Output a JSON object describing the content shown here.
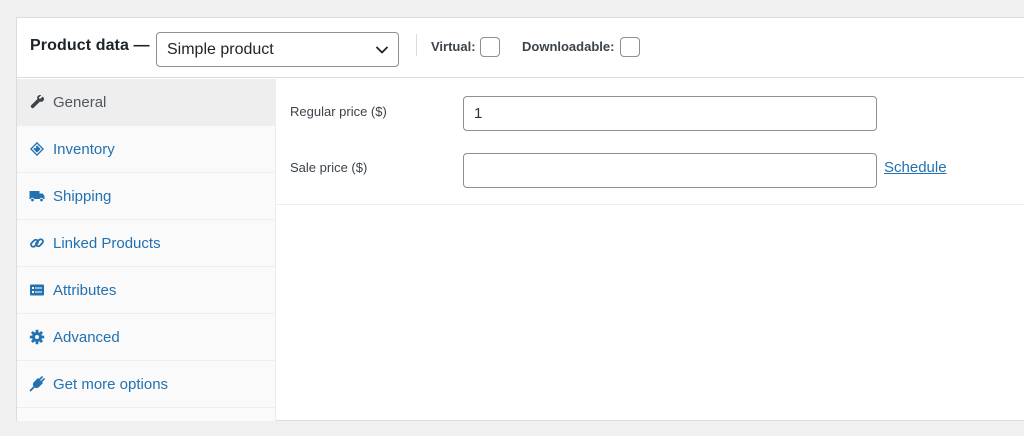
{
  "header": {
    "title": "Product data —",
    "product_type": "Simple product",
    "virtual_label": "Virtual:",
    "downloadable_label": "Downloadable:"
  },
  "tabs": [
    {
      "label": "General",
      "icon": "wrench-icon",
      "active": true
    },
    {
      "label": "Inventory",
      "icon": "tag-icon",
      "active": false
    },
    {
      "label": "Shipping",
      "icon": "truck-icon",
      "active": false
    },
    {
      "label": "Linked Products",
      "icon": "link-icon",
      "active": false
    },
    {
      "label": "Attributes",
      "icon": "list-card-icon",
      "active": false
    },
    {
      "label": "Advanced",
      "icon": "gear-icon",
      "active": false
    },
    {
      "label": "Get more options",
      "icon": "plugin-icon",
      "active": false
    }
  ],
  "general": {
    "regular_price_label": "Regular price ($)",
    "regular_price_value": "1",
    "sale_price_label": "Sale price ($)",
    "sale_price_value": "",
    "schedule_link": "Schedule"
  },
  "colors": {
    "link": "#2271b1",
    "active_tab_bg": "#eeeeee",
    "tab_bg": "#fafafa",
    "page_bg": "#f0f0f1"
  }
}
